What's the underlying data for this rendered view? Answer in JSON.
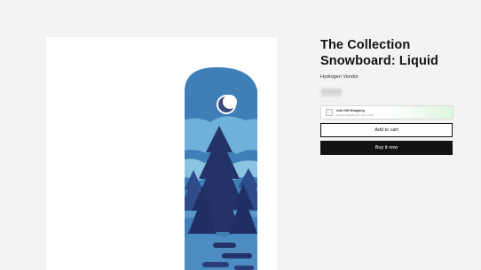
{
  "product": {
    "title": "The Collection Snowboard: Liquid",
    "vendor": "Hydrogen Vendor",
    "price": "$749.95"
  },
  "gift_wrap": {
    "title": "Add Gift Wrapping",
    "subtitle": "Festive wrapping for your order"
  },
  "buttons": {
    "add_to_cart": "Add to cart",
    "buy_now": "Buy it now"
  },
  "colors": {
    "board_blue": "#3f7fb8",
    "board_light": "#6fb1d8",
    "tree_navy": "#23336a",
    "moon": "#3b4a7a",
    "button_black": "#121212"
  }
}
